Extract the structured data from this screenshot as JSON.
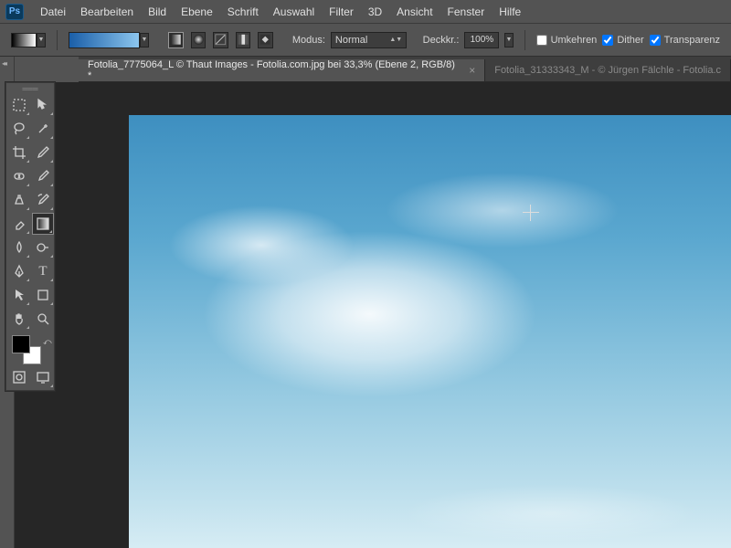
{
  "app": {
    "logo": "Ps"
  },
  "menu": [
    "Datei",
    "Bearbeiten",
    "Bild",
    "Ebene",
    "Schrift",
    "Auswahl",
    "Filter",
    "3D",
    "Ansicht",
    "Fenster",
    "Hilfe"
  ],
  "options": {
    "mode_label": "Modus:",
    "mode_value": "Normal",
    "opacity_label": "Deckkr.:",
    "opacity_value": "100%",
    "reverse_label": "Umkehren",
    "dither_label": "Dither",
    "transparency_label": "Transparenz",
    "reverse_checked": false,
    "dither_checked": true,
    "transparency_checked": true
  },
  "tabs": [
    {
      "title": "Fotolia_7775064_L © Thaut Images - Fotolia.com.jpg bei 33,3% (Ebene 2, RGB/8) *",
      "active": true
    },
    {
      "title": "Fotolia_31333343_M - © Jürgen Fälchle - Fotolia.c",
      "active": false
    }
  ],
  "tools": {
    "names": [
      "marquee",
      "move",
      "lasso",
      "magic-wand",
      "crop",
      "eyedropper",
      "healing",
      "brush",
      "clone",
      "history-brush",
      "eraser",
      "gradient",
      "blur",
      "dodge",
      "pen",
      "type",
      "path-select",
      "shape",
      "hand",
      "zoom"
    ],
    "selected": "gradient"
  },
  "colors": {
    "fg": "#000000",
    "bg": "#ffffff"
  }
}
